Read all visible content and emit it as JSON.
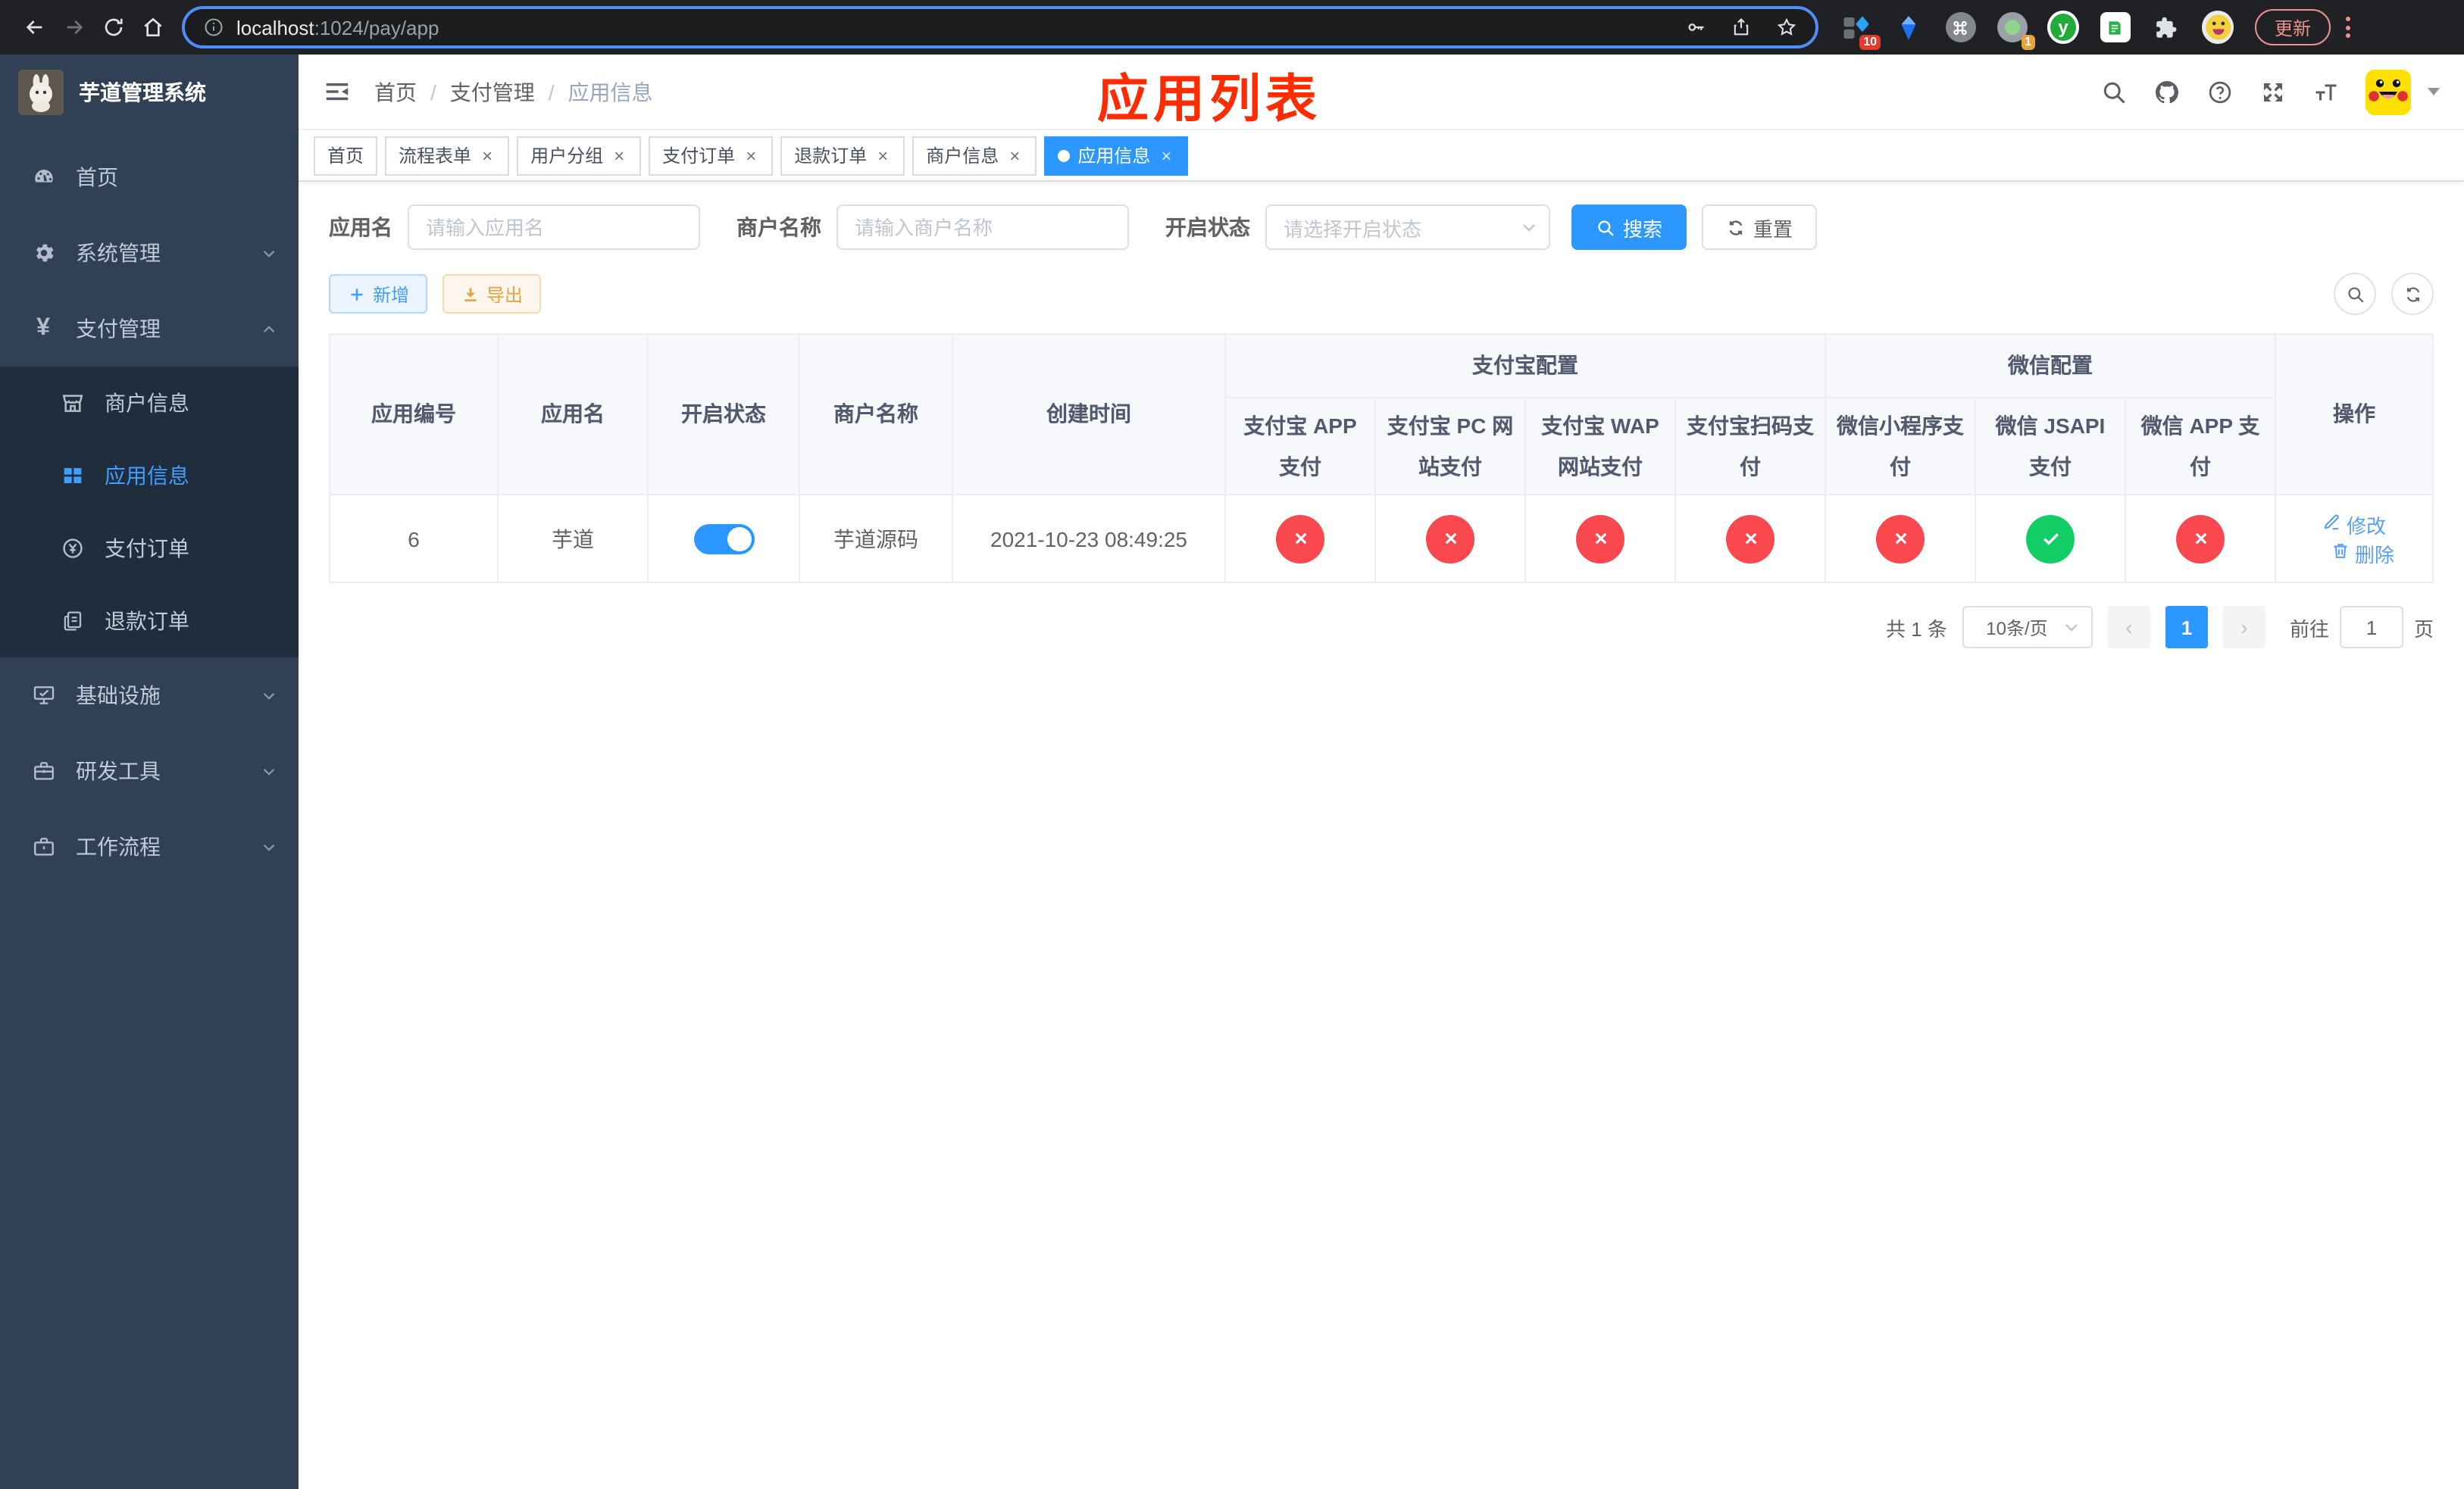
{
  "colors": {
    "primary": "#2c97ff",
    "danger": "#f9494f",
    "success": "#13ce66",
    "annotation_red": "#fe2c00"
  },
  "browser": {
    "url_host": "localhost",
    "url_path": ":1024/pay/app",
    "update_label": "更新",
    "ext_badge_1": "10",
    "ext_badge_2": "1"
  },
  "sidebar": {
    "title": "芋道管理系统",
    "items": [
      {
        "id": "home",
        "label": "首页",
        "icon": "dashboard-icon"
      },
      {
        "id": "system",
        "label": "系统管理",
        "icon": "gear-icon",
        "chevron": "down"
      },
      {
        "id": "payment",
        "label": "支付管理",
        "icon": "yen-icon",
        "chevron": "up",
        "open": true,
        "children": [
          {
            "id": "merchant-info",
            "label": "商户信息",
            "icon": "shop-icon"
          },
          {
            "id": "app-info",
            "label": "应用信息",
            "icon": "grid-icon",
            "active": true
          },
          {
            "id": "pay-order",
            "label": "支付订单",
            "icon": "pay-order-icon"
          },
          {
            "id": "refund-order",
            "label": "退款订单",
            "icon": "refund-order-icon"
          }
        ]
      },
      {
        "id": "infrastructure",
        "label": "基础设施",
        "icon": "infra-icon",
        "chevron": "down"
      },
      {
        "id": "dev-tools",
        "label": "研发工具",
        "icon": "toolbox-icon",
        "chevron": "down"
      },
      {
        "id": "workflow",
        "label": "工作流程",
        "icon": "briefcase-icon",
        "chevron": "down"
      }
    ]
  },
  "navbar": {
    "breadcrumb": [
      "首页",
      "支付管理",
      "应用信息"
    ]
  },
  "annotation": {
    "title": "应用列表"
  },
  "tabs": [
    {
      "label": "首页",
      "closable": false,
      "active": false
    },
    {
      "label": "流程表单",
      "closable": true,
      "active": false
    },
    {
      "label": "用户分组",
      "closable": true,
      "active": false
    },
    {
      "label": "支付订单",
      "closable": true,
      "active": false
    },
    {
      "label": "退款订单",
      "closable": true,
      "active": false
    },
    {
      "label": "商户信息",
      "closable": true,
      "active": false
    },
    {
      "label": "应用信息",
      "closable": true,
      "active": true
    }
  ],
  "filters": {
    "app_name_label": "应用名",
    "app_name_placeholder": "请输入应用名",
    "merchant_label": "商户名称",
    "merchant_placeholder": "请输入商户名称",
    "status_label": "开启状态",
    "status_placeholder": "请选择开启状态",
    "search_label": "搜索",
    "reset_label": "重置"
  },
  "toolbar": {
    "add_label": "新增",
    "export_label": "导出"
  },
  "table": {
    "columns": {
      "id": "应用编号",
      "name": "应用名",
      "status": "开启状态",
      "merchant": "商户名称",
      "created": "创建时间",
      "actions": "操作"
    },
    "alipay_group": {
      "label": "支付宝配置",
      "cols": [
        "支付宝 APP 支付",
        "支付宝 PC 网站支付",
        "支付宝 WAP 网站支付",
        "支付宝扫码支付"
      ]
    },
    "wechat_group": {
      "label": "微信配置",
      "cols": [
        "微信小程序支付",
        "微信 JSAPI 支付",
        "微信 APP 支付"
      ]
    },
    "rows": [
      {
        "id": "6",
        "name": "芋道",
        "enabled": true,
        "merchant": "芋道源码",
        "created": "2021-10-23 08:49:25",
        "pay_status": [
          false,
          false,
          false,
          false,
          false,
          true,
          false
        ]
      }
    ],
    "action_edit": "修改",
    "action_delete": "删除"
  },
  "pagination": {
    "total": "共 1 条",
    "page_size": "10条/页",
    "current_page": "1",
    "goto_label": "前往",
    "goto_value": "1",
    "page_unit": "页"
  }
}
